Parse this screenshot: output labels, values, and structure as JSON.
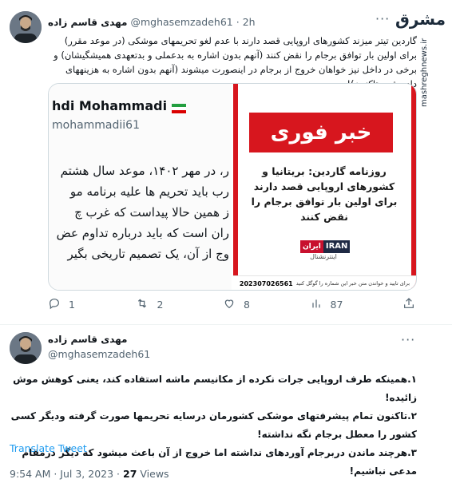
{
  "watermark": {
    "brand": "مشرق",
    "site": "mashreghnews.ir"
  },
  "tweet1": {
    "author_name": "مهدی قاسم زاده",
    "handle": "@mghasemzadeh61",
    "time": "2h",
    "text": "گاردین تیتر میزند کشورهای اروپایی قصد دارند با عدم لغو تحریمهای موشکی (در موعد مقرر) برای اولین بار توافق برجام را نقض کنند (آنهم بدون اشاره به بدعملی و بدتعهدی همیشگیشان) و برخی در داخل نیز خواهان خروج از برجام در اینصورت میشوند (آنهم بدون اشاره به هزینههای داده شده تاکنون)!",
    "left_image": {
      "name": "hdi Mohammadi",
      "handle": "mohammadii61",
      "lines": [
        "ر، در مهر ۱۴۰۲، موعد سال هشتم",
        "رب باید تحریم ها علیه برنامه مو",
        "ز همین حالا پیداست که غرب چ",
        "ران است که باید درباره تداوم عض",
        "وج از آن، یک تصمیم تاریخی بگیر"
      ]
    },
    "right_image": {
      "headline": "خبر فوری",
      "body": "روزنامه گاردین: بریتانیا و کشورهای اروپایی قصد دارند برای اولین بار توافق برجام را نقض کنند",
      "logo_top": "IRAN",
      "logo_fa": "ایران",
      "logo_sub": "اینترنشنال",
      "footer": "برای تایید و خواندن متن خبر این شماره را گوگل کنید",
      "code": "202307026561"
    },
    "actions": {
      "replies": "1",
      "retweets": "2",
      "likes": "8",
      "views": "87"
    }
  },
  "tweet2": {
    "author_name": "مهدی قاسم زاده",
    "handle": "@mghasemzadeh61",
    "points": [
      "۱.همینکه طرف اروپایی جرات نکرده از مکانیسم ماشه استفاده کند، یعنی کوهش موش زائیده!",
      "۲.تاکنون تمام پیشرفتهای موشکی کشورمان درسایه تحریمها صورت گرفته ودیگر کسی کشور را معطل برجام نگه نداشته!",
      "۳.هرچند ماندن دربرجام آوردهای نداشته اما خروج از آن باعث میشود که دیگر درمقام مدعی نباشیم!"
    ],
    "translate": "Translate Tweet",
    "meta_time": "9:54 AM · Jul 3, 2023 · ",
    "views_count": "27",
    "views_label": " Views"
  },
  "colors": {
    "link": "#1d9bf0",
    "urgent_red": "#d7161e",
    "muted": "#536471",
    "iran_red": "#c8102e"
  }
}
